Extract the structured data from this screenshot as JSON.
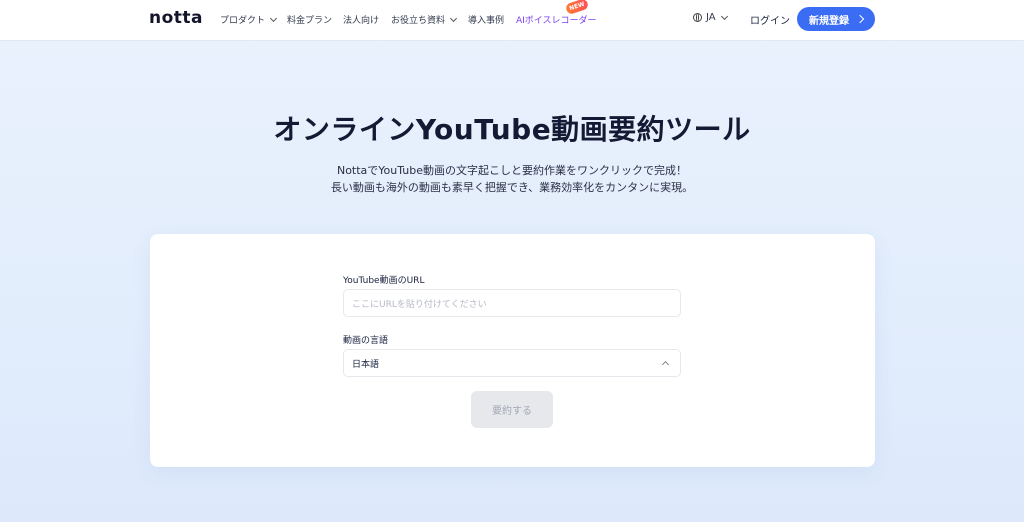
{
  "nav": {
    "logo": "notta",
    "items": [
      {
        "label": "プロダクト",
        "dropdown": true
      },
      {
        "label": "料金プラン",
        "dropdown": false
      },
      {
        "label": "法人向け",
        "dropdown": false
      },
      {
        "label": "お役立ち資料",
        "dropdown": true
      },
      {
        "label": "導入事例",
        "dropdown": false
      },
      {
        "label": "AIボイスレコーダー",
        "dropdown": false
      }
    ],
    "new_badge": "NEW",
    "language": "JA",
    "login": "ログイン",
    "signup": "新規登録"
  },
  "hero": {
    "title": "オンラインYouTube動画要約ツール",
    "subtitle_line1": "NottaでYouTube動画の文字起こしと要約作業をワンクリックで完成！",
    "subtitle_line2": "長い動画も海外の動画も素早く把握でき、業務効率化をカンタンに実現。"
  },
  "form": {
    "url_label": "YouTube動画のURL",
    "url_placeholder": "ここにURLを貼り付けてください",
    "url_value": "",
    "language_label": "動画の言語",
    "language_value": "日本語",
    "submit_label": "要約する"
  },
  "colors": {
    "accent": "#3a6cf4",
    "ai_link": "#7a3ff2",
    "badge": "#ff5a45"
  }
}
